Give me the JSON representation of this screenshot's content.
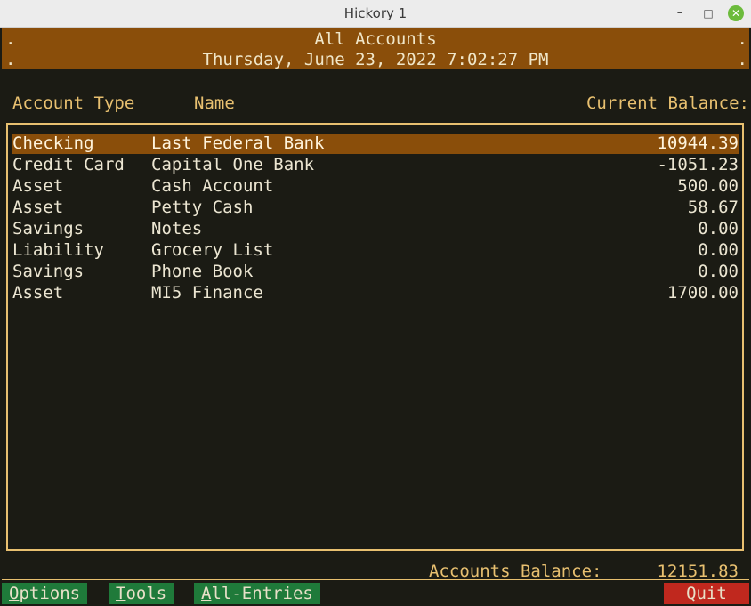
{
  "window": {
    "title": "Hickory 1"
  },
  "header": {
    "title": "All Accounts",
    "datetime": "Thursday, June 23, 2022  7:02:27 PM",
    "dot": "."
  },
  "columns": {
    "type": "Account Type",
    "name": "Name",
    "balance": "Current Balance:"
  },
  "accounts": [
    {
      "type": "Checking",
      "name": "Last Federal Bank",
      "balance": "10944.39"
    },
    {
      "type": "Credit Card",
      "name": "Capital One Bank",
      "balance": "-1051.23"
    },
    {
      "type": "Asset",
      "name": "Cash Account",
      "balance": "500.00"
    },
    {
      "type": "Asset",
      "name": "Petty Cash",
      "balance": "58.67"
    },
    {
      "type": "Savings",
      "name": "Notes",
      "balance": "0.00"
    },
    {
      "type": "Liability",
      "name": "Grocery List",
      "balance": "0.00"
    },
    {
      "type": "Savings",
      "name": "Phone Book",
      "balance": "0.00"
    },
    {
      "type": "Asset",
      "name": "MI5 Finance",
      "balance": "1700.00"
    }
  ],
  "selected_row": 0,
  "totals": {
    "label": "Accounts Balance:",
    "value": "12151.83"
  },
  "footer": {
    "options": {
      "hotkey": "O",
      "rest": "ptions"
    },
    "tools": {
      "hotkey": "T",
      "rest": "ools"
    },
    "entries": {
      "hotkey": "A",
      "rest": "ll-Entries"
    },
    "quit": "Quit"
  },
  "colors": {
    "accent": "#8a4e0a",
    "label": "#e8c070",
    "button": "#1f7a3a",
    "quit": "#c0281e",
    "background": "#1b1b14"
  }
}
